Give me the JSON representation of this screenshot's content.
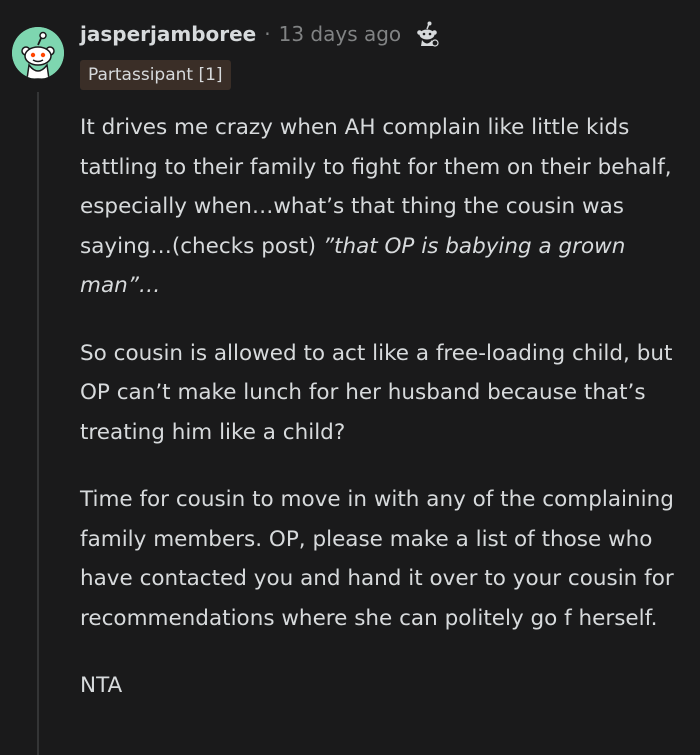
{
  "comment": {
    "username": "jasperjamboree",
    "separator": "·",
    "timestamp": "13 days ago",
    "flair": "Partassipant [1]",
    "award_icon": "snoo-award-icon",
    "avatar_icon": "snoo-avatar-icon",
    "paragraphs": [
      {
        "text": "It drives me crazy when AH complain like little kids tattling to their family to fight for them on their behalf, especially when…what’s that thing the cousin was saying…(checks post) ",
        "italic": "”that OP is babying a grown man”…"
      },
      {
        "text": "So cousin is allowed to act like a free-loading child, but OP can’t make lunch for her husband because that’s treating him like a child?"
      },
      {
        "text": "Time for cousin to move in with any of the complaining family members. OP, please make a list of those who have contacted you and hand it over to your cousin for recommendations where she can politely go f herself."
      },
      {
        "text": "NTA"
      }
    ]
  },
  "colors": {
    "background": "#1a1a1b",
    "text": "#d7dadc",
    "muted": "#818384",
    "avatar_bg": "#7ed6b0",
    "flair_bg": "#3a2e27",
    "thread_line": "#343536"
  }
}
